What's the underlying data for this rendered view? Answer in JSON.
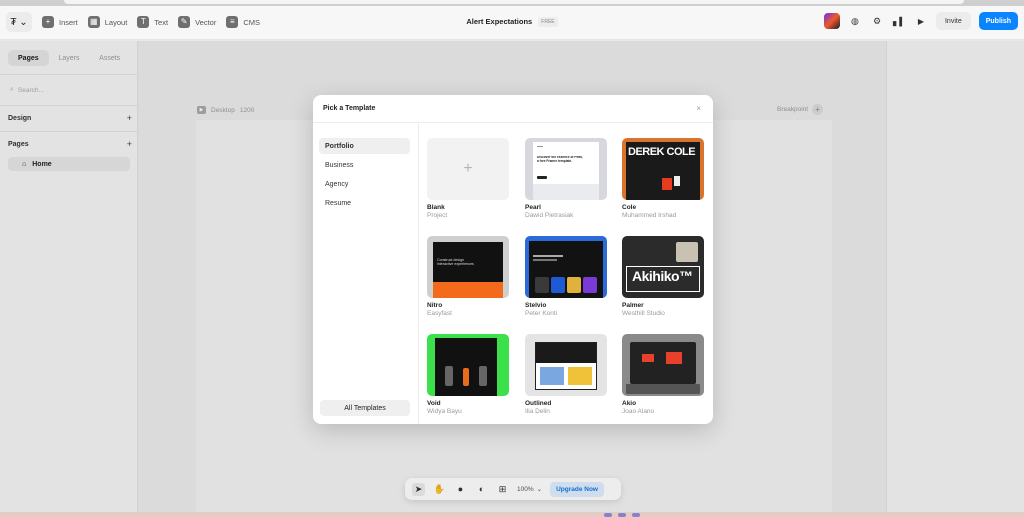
{
  "toolbar": {
    "logo": "₮ ⌄",
    "items": [
      {
        "label": "Insert",
        "icon": "plus-square-icon"
      },
      {
        "label": "Layout",
        "icon": "layout-icon"
      },
      {
        "label": "Text",
        "icon": "text-icon"
      },
      {
        "label": "Vector",
        "icon": "vector-pen-icon"
      },
      {
        "label": "CMS",
        "icon": "database-icon"
      }
    ],
    "project_title": "Alert Expectations",
    "plan_badge": "FREE",
    "invite_label": "Invite",
    "publish_label": "Publish"
  },
  "left_panel": {
    "tabs": [
      "Pages",
      "Layers",
      "Assets"
    ],
    "search_placeholder": "Search...",
    "design_label": "Design",
    "pages_label": "Pages",
    "home_page": "Home"
  },
  "canvas": {
    "frame_label": "Desktop",
    "frame_width": "1200",
    "breakpoint_label": "Breakpoint"
  },
  "modal": {
    "title": "Pick a Template",
    "close": "×",
    "categories": [
      "Portfolio",
      "Business",
      "Agency",
      "Resume"
    ],
    "active_category": "Portfolio",
    "all_templates_label": "All Templates",
    "templates": [
      {
        "name": "Blank",
        "author": "Project"
      },
      {
        "name": "Pearl",
        "author": "Dawid Pietrasiak"
      },
      {
        "name": "Cole",
        "author": "Muhammed Irshad"
      },
      {
        "name": "Nitro",
        "author": "Easyfast"
      },
      {
        "name": "Stelvio",
        "author": "Peter Konti"
      },
      {
        "name": "Palmer",
        "author": "Westhill Studio"
      },
      {
        "name": "Void",
        "author": "Widya Bayu"
      },
      {
        "name": "Outlined",
        "author": "Ilia Delin"
      },
      {
        "name": "Akio",
        "author": "Joao Alano"
      }
    ],
    "thumb_text": {
      "pearl_headline": "Discover the essence of Pearl, a free Framer template.",
      "cole": "DEREK COLE",
      "nitro": "Construct design interactive experiences",
      "palmer": "Akihiko™"
    }
  },
  "bottom_bar": {
    "zoom": "100%",
    "upgrade_label": "Upgrade Now"
  },
  "colors": {
    "accent": "#0a84ff",
    "upgrade_bg": "#dfeeff",
    "upgrade_text": "#1877e8"
  }
}
